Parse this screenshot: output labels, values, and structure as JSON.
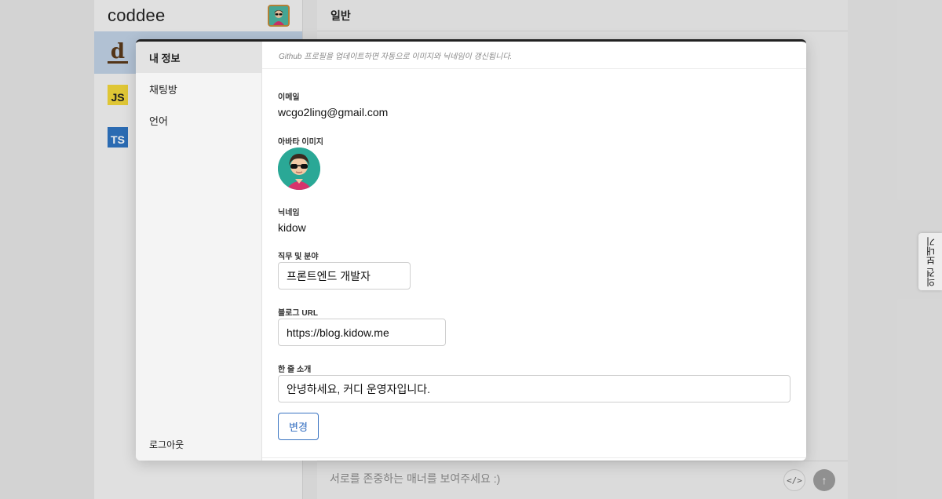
{
  "app": {
    "brand": "coddee"
  },
  "sidebar": {
    "channels": [
      {
        "icon": "d",
        "name": "d-channel-icon"
      },
      {
        "icon": "JS",
        "name": "js-channel-icon"
      },
      {
        "icon": "TS",
        "name": "ts-channel-icon"
      }
    ]
  },
  "main": {
    "title": "일반",
    "composer_placeholder": "서로를 존중하는 매너를 보여주세요 :)",
    "code_icon": "</>",
    "send_icon": "↑"
  },
  "feedback": {
    "label": "의견 보내기"
  },
  "modal": {
    "nav": {
      "profile": "내 정보",
      "chatroom": "채팅방",
      "language": "언어",
      "logout": "로그아웃"
    },
    "notice": "Github 프로필을 업데이트하면 자동으로 이미지와 닉네임이 갱신됩니다.",
    "email": {
      "label": "이메일",
      "value": "wcgo2ling@gmail.com"
    },
    "avatar": {
      "label": "아바타 이미지"
    },
    "nickname": {
      "label": "닉네임",
      "value": "kidow"
    },
    "job": {
      "label": "직무 및 분야",
      "value": "프론트엔드 개발자"
    },
    "blog": {
      "label": "블로그 URL",
      "value": "https://blog.kidow.me"
    },
    "bio": {
      "label": "한 줄 소개",
      "value": "안녕하세요, 커디 운영자입니다."
    },
    "submit": "변경"
  },
  "colors": {
    "accent": "#2f6bbf",
    "active_channel": "#bfd0e4"
  }
}
